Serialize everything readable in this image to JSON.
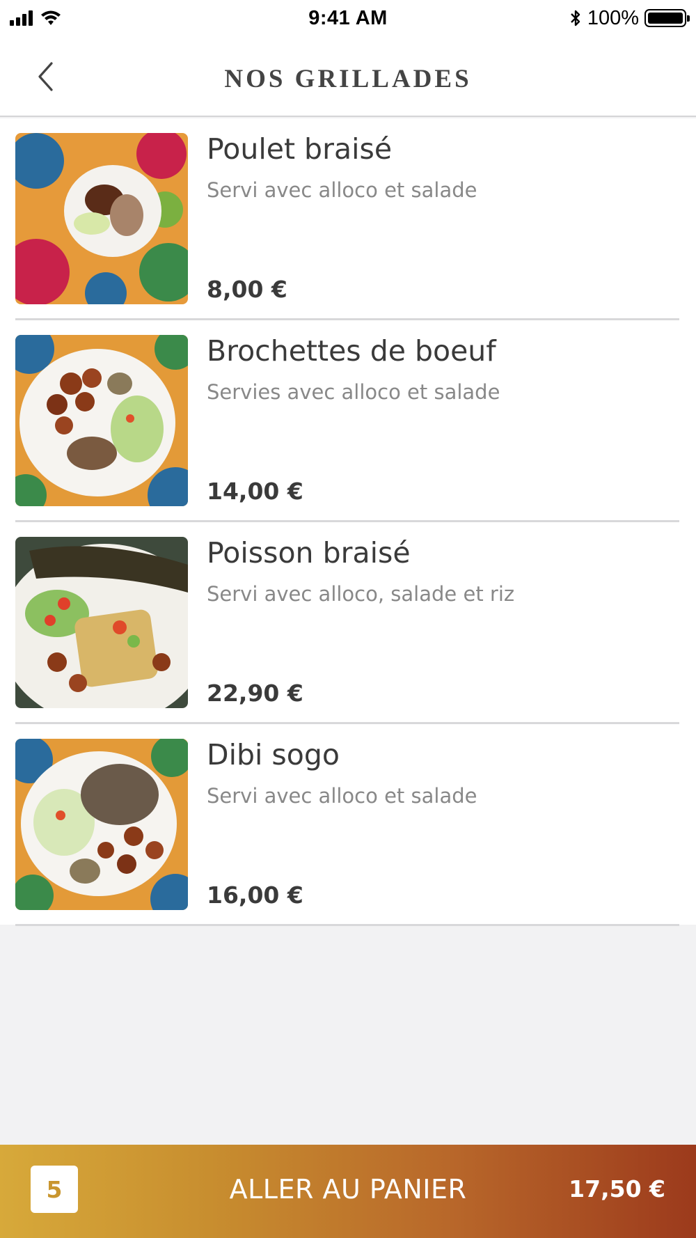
{
  "status_bar": {
    "time": "9:41 AM",
    "battery_percent": "100%",
    "icons": [
      "signal-icon",
      "wifi-icon",
      "bluetooth-icon",
      "battery-icon"
    ]
  },
  "nav": {
    "title": "NOS GRILLADES",
    "back_icon": "chevron-left-icon"
  },
  "items": [
    {
      "name": "Poulet braisé",
      "description": "Servi avec alloco et salade",
      "price": "8,00 €"
    },
    {
      "name": "Brochettes de boeuf",
      "description": "Servies avec alloco et salade",
      "price": "14,00 €"
    },
    {
      "name": "Poisson braisé",
      "description": "Servi avec alloco, salade et riz",
      "price": "22,90 €"
    },
    {
      "name": "Dibi sogo",
      "description": "Servi avec alloco et salade",
      "price": "16,00 €"
    }
  ],
  "cart": {
    "count": "5",
    "label": "ALLER AU PANIER",
    "total": "17,50 €"
  },
  "colors": {
    "accent_start": "#d7a93a",
    "accent_end": "#9c3a1c",
    "count_text": "#c9962f"
  }
}
